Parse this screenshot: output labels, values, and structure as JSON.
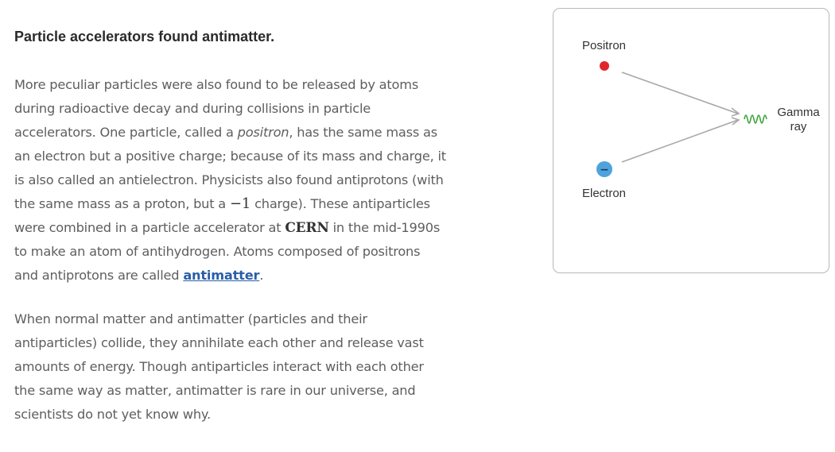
{
  "section": {
    "heading": "Particle accelerators found antimatter.",
    "paragraph1": {
      "part1": "More peculiar particles were also found to be released by atoms during radioactive decay and during collisions in particle accelerators. One particle, called a ",
      "positron_term": "positron",
      "part2": ", has the same mass as an electron but a positive charge; because of its mass and charge, it is also called an antielectron. Physicists also found antiprotons (with the same mass as a proton, but a ",
      "charge_value": "−1",
      "part3": " charge). These antiparticles were combined in a particle accelerator at ",
      "cern": "CERN",
      "part4": " in the mid-1990s to make an atom of antihydrogen. Atoms composed of positrons and antiprotons are called ",
      "antimatter_link": "antimatter",
      "part5": "."
    },
    "paragraph2": "When normal matter and antimatter (particles and their antiparticles) collide, they annihilate each other and release vast amounts of energy. Though antiparticles interact with each other the same way as matter, antimatter is rare in our universe, and scientists do not yet know why."
  },
  "diagram": {
    "positron_label": "Positron",
    "electron_label": "Electron",
    "electron_symbol": "−",
    "gamma_label_line1": "Gamma",
    "gamma_label_line2": "ray",
    "colors": {
      "positron": "#e0262d",
      "electron": "#4ea3dd",
      "gamma_wave": "#3aa43a",
      "arrow": "#a8a8a8"
    }
  }
}
